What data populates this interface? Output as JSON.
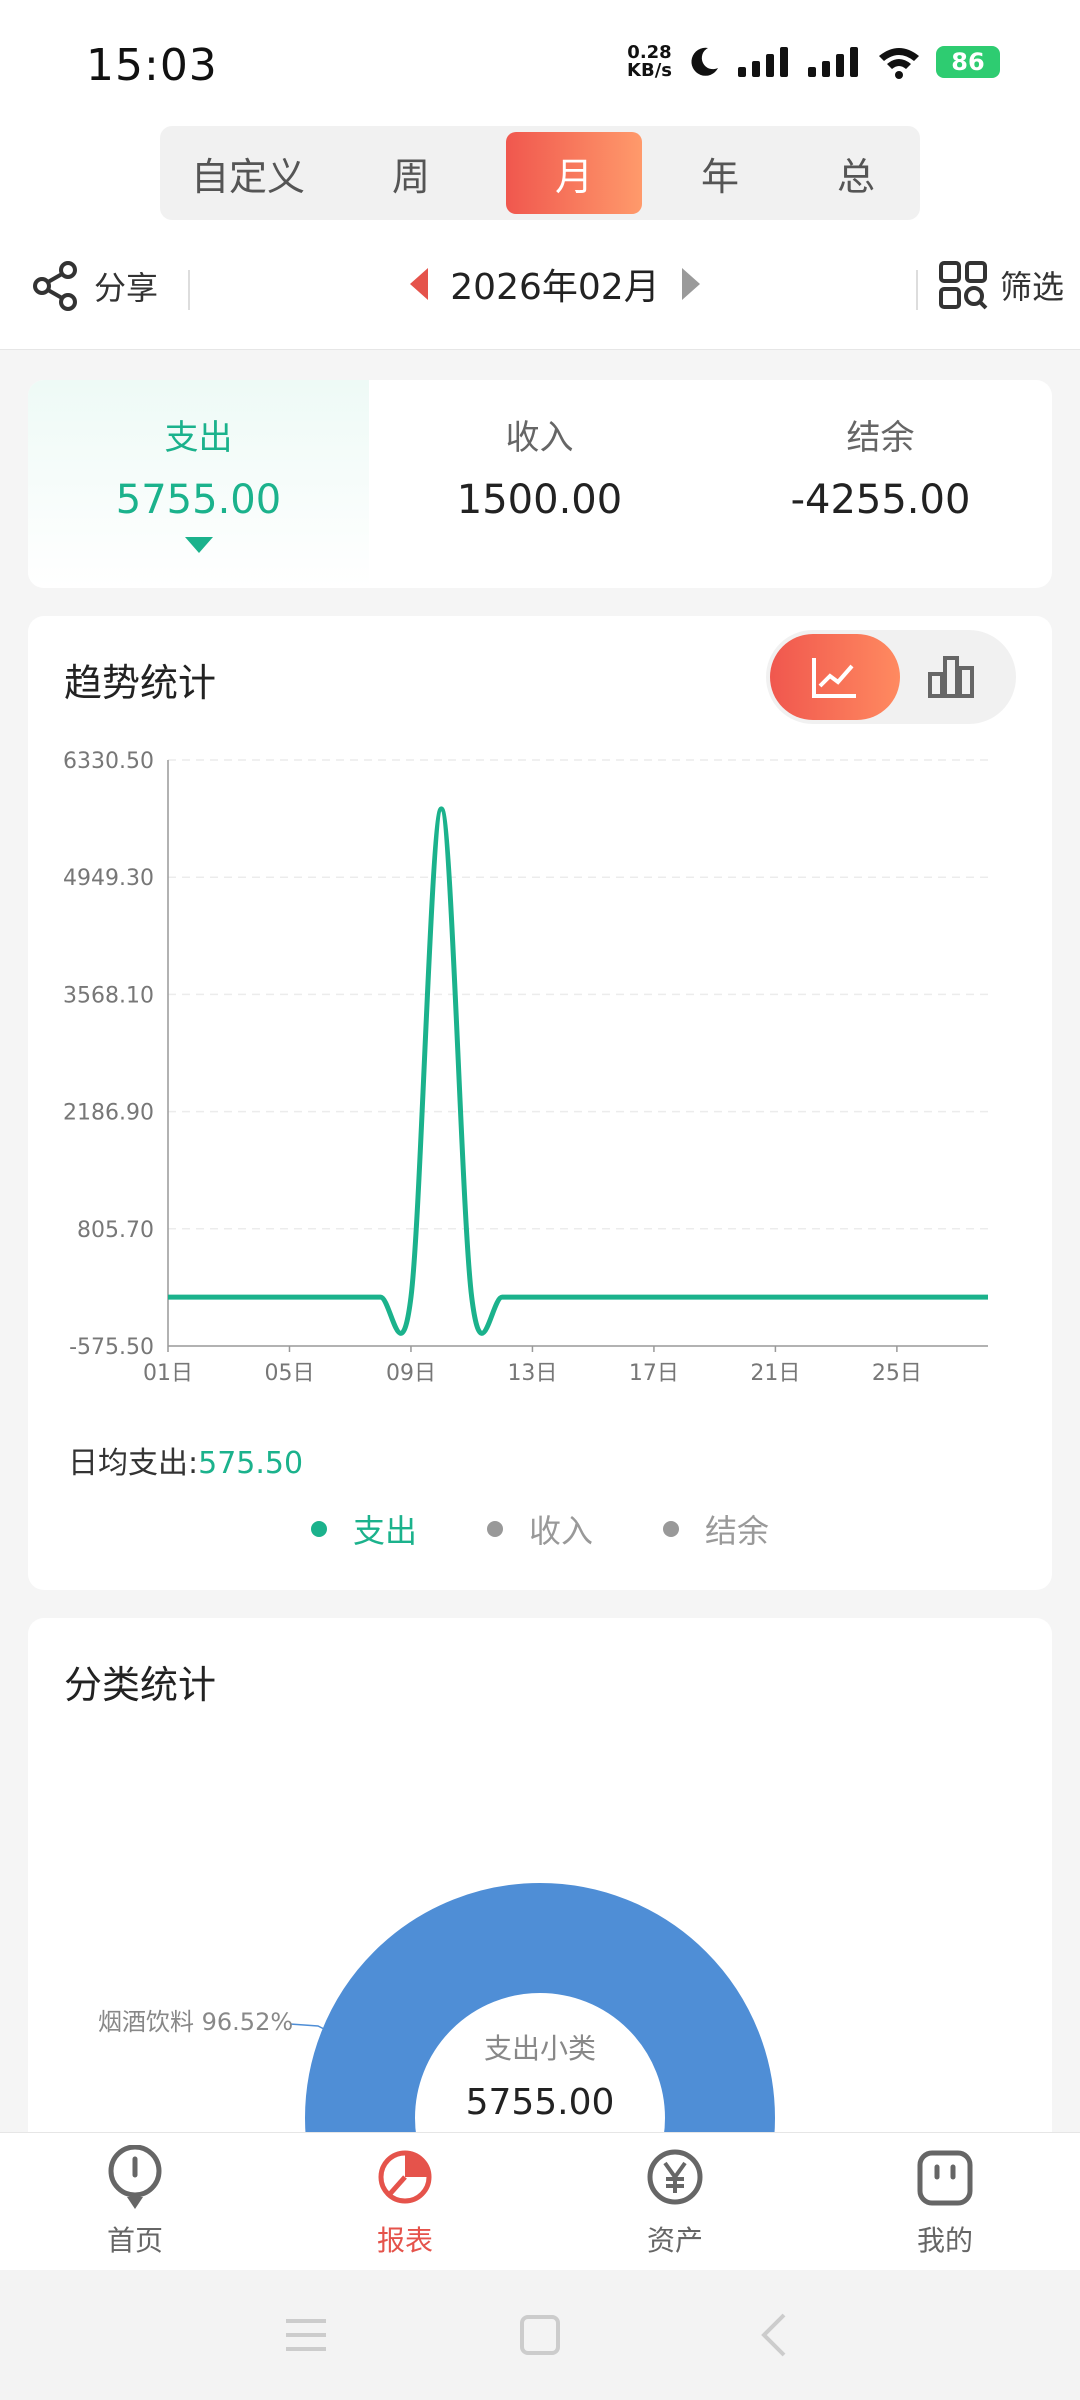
{
  "status_bar": {
    "time": "15:03",
    "net_speed_value": "0.28",
    "net_speed_unit": "KB/s",
    "battery": "86"
  },
  "period_tabs": [
    {
      "label": "自定义",
      "active": false
    },
    {
      "label": "周",
      "active": false
    },
    {
      "label": "月",
      "active": true
    },
    {
      "label": "年",
      "active": false
    },
    {
      "label": "总",
      "active": false
    }
  ],
  "toolbar": {
    "share_label": "分享",
    "current_month": "2026年02月",
    "filter_label": "筛选"
  },
  "summary": {
    "expense_label": "支出",
    "expense_value": "5755.00",
    "income_label": "收入",
    "income_value": "1500.00",
    "balance_label": "结余",
    "balance_value": "-4255.00"
  },
  "trend": {
    "title": "趋势统计",
    "daily_avg_label": "日均支出:",
    "daily_avg_value": "575.50",
    "legend": [
      {
        "label": "支出",
        "active": true
      },
      {
        "label": "收入",
        "active": false
      },
      {
        "label": "结余",
        "active": false
      }
    ]
  },
  "chart_data": {
    "type": "line",
    "x_tick_labels": [
      "01日",
      "05日",
      "09日",
      "13日",
      "17日",
      "21日",
      "25日"
    ],
    "y_tick_labels": [
      "6330.50",
      "4949.30",
      "3568.10",
      "2186.90",
      "805.70",
      "-575.50"
    ],
    "ylim": [
      -575.5,
      6330.5
    ],
    "days": 28,
    "series": [
      {
        "name": "支出",
        "color": "#1bb28c",
        "values": [
          0,
          0,
          0,
          0,
          0,
          0,
          0,
          0,
          0,
          5755,
          0,
          0,
          0,
          0,
          0,
          0,
          0,
          0,
          0,
          0,
          0,
          0,
          0,
          0,
          0,
          0,
          0,
          0
        ]
      }
    ],
    "grid": true
  },
  "category": {
    "title": "分类统计",
    "center_label": "支出小类",
    "center_value": "5755.00",
    "slice_label": "烟酒饮料 96.52%"
  },
  "bottom_nav": [
    {
      "label": "首页",
      "icon": "pin-icon",
      "active": false
    },
    {
      "label": "报表",
      "icon": "pie-chart-icon",
      "active": true
    },
    {
      "label": "资产",
      "icon": "yen-icon",
      "active": false
    },
    {
      "label": "我的",
      "icon": "face-icon",
      "active": false
    }
  ],
  "colors": {
    "accent": "#e5534b",
    "expense": "#1bb28c",
    "pie": "#4f8ed6"
  }
}
